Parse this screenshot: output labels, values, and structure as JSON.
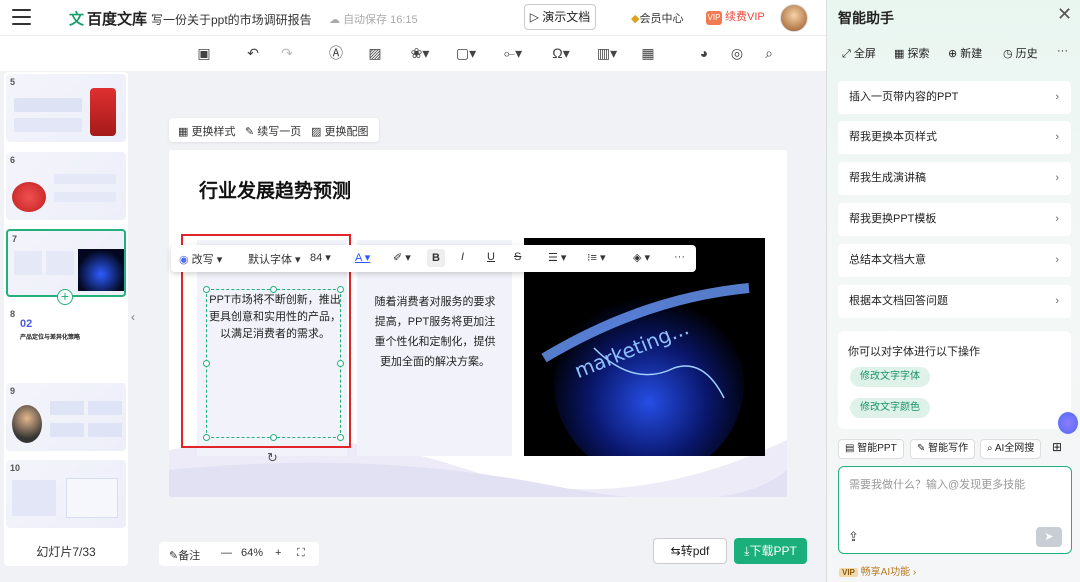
{
  "app": {
    "name": "百度文库",
    "doc_title": "写一份关于ppt的市场调研报告",
    "autosave": "自动保存 16:15",
    "present": "演示文档",
    "member": "会员中心",
    "vip": "续费VIP"
  },
  "toolbar_icons": [
    "save-icon",
    "undo-icon",
    "redo-icon",
    "text-icon",
    "image-icon",
    "shape-icon",
    "chart-shape-icon",
    "connector-icon",
    "symbol-icon",
    "chart-icon",
    "table-icon",
    "palette-icon",
    "animation-icon",
    "search-icon"
  ],
  "slides": {
    "count_label": "幻灯片7/33",
    "thumbs": [
      {
        "num": "5"
      },
      {
        "num": "6"
      },
      {
        "num": "7"
      },
      {
        "num": "8",
        "big": "02",
        "text": "产品定位与差异化策略"
      },
      {
        "num": "9"
      },
      {
        "num": "10"
      }
    ]
  },
  "slide_actions": {
    "style": "更换样式",
    "continue": "续写一页",
    "image": "更换配图"
  },
  "slide": {
    "title": "行业发展趋势预测",
    "card1_text": "PPT市场将不断创新，推出更具创意和实用性的产品，以满足消费者的需求。",
    "card2_text": "随着消费者对服务的要求提高，PPT服务将更加注重个性化和定制化，提供更加全面的解决方案。",
    "image_text": "marketing..."
  },
  "format_bar": {
    "rewrite": "改写",
    "font": "默认字体",
    "size": "84"
  },
  "bottom": {
    "notes": "备注",
    "zoom": "64%",
    "to_pdf": "转pdf",
    "download": "下载PPT"
  },
  "assistant": {
    "title": "智能助手",
    "tabs": [
      "全屏",
      "探索",
      "新建",
      "历史"
    ],
    "suggestions": [
      "插入一页带内容的PPT",
      "帮我更换本页样式",
      "帮我生成演讲稿",
      "帮我更换PPT模板",
      "总结本文档大意",
      "根据本文档回答问题"
    ],
    "hint_title": "你可以对字体进行以下操作",
    "hint_pills": [
      "修改文字字体",
      "修改文字颜色"
    ],
    "tools": [
      "智能PPT",
      "智能写作",
      "AI全网搜"
    ],
    "input_placeholder": "需要我做什么？输入@发现更多技能",
    "vip_tag": "VIP",
    "vip_text": "畅享AI功能"
  },
  "colors": {
    "accent": "#1bb07b",
    "highlight": "#e0242a"
  }
}
